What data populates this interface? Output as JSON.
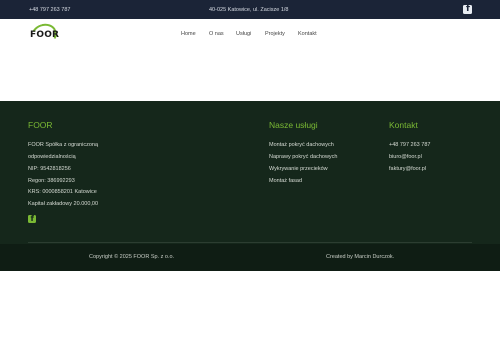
{
  "topbar": {
    "phone": "+48 797 263 787",
    "address": "40-025 Katowice, ul. Zacisze 1/8",
    "facebook_icon": "facebook-icon"
  },
  "header": {
    "logo_text": "FOOR",
    "nav": [
      "Home",
      "O nas",
      "Usługi",
      "Projekty",
      "Kontakt"
    ]
  },
  "footer": {
    "company": {
      "heading": "FOOR",
      "lines": [
        "FOOR Spółka z ograniczoną",
        "odpowiedzialnością",
        "NIP: 9542818256",
        "Regon: 386992293",
        "KRS: 0000858201 Katowice",
        "Kapitał zakładowy 20.000,00"
      ]
    },
    "services": {
      "heading": "Nasze usługi",
      "items": [
        "Montaż pokryć dachowych",
        "Naprawy pokryć dachowych",
        "Wykrywanie przecieków",
        "Montaż fasad"
      ]
    },
    "contact": {
      "heading": "Kontakt",
      "items": [
        "+48 797 263 787",
        "biuro@foor.pl",
        "faktury@foor.pl"
      ]
    },
    "copyright": "Copyright © 2025 FOOR Sp. z o.o.",
    "credit": "Created by Marcin Durczok."
  },
  "colors": {
    "topbar": "#1b2437",
    "footer": "#15271b",
    "accent": "#7ab934"
  }
}
